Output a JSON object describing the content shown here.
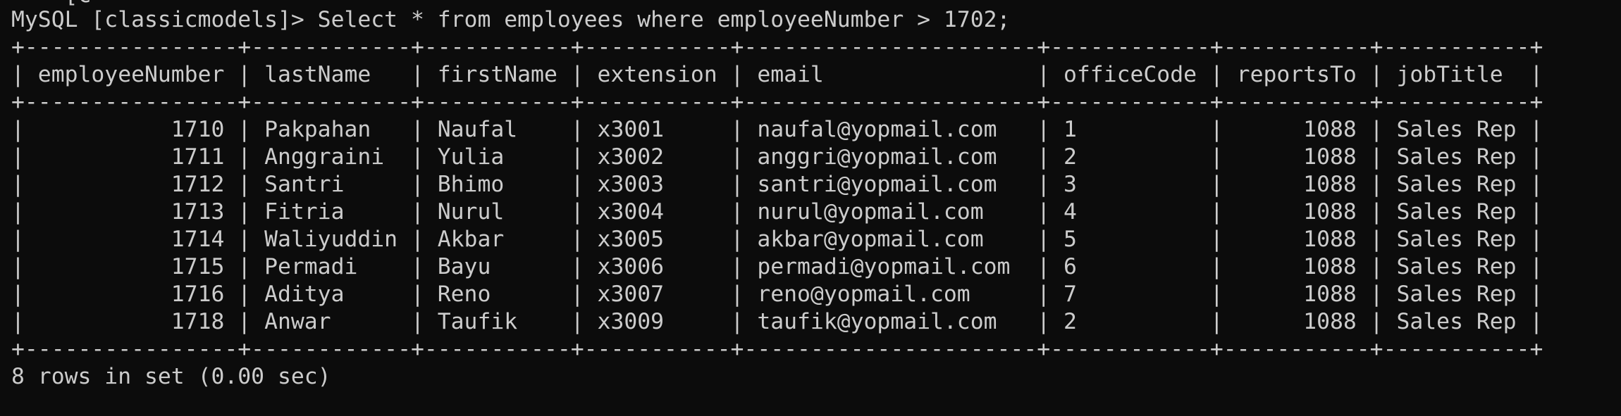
{
  "terminal": {
    "clipped_top_line": "    [c",
    "prompt_line": "MySQL [classicmodels]> Select * from employees where employeeNumber > 1702;",
    "table": {
      "border": "+----------------+------------+-----------+-----------+----------------------+------------+-----------+-----------+",
      "header": "| employeeNumber | lastName   | firstName | extension | email                | officeCode | reportsTo | jobTitle  |",
      "rows": [
        "|           1710 | Pakpahan   | Naufal    | x3001     | naufal@yopmail.com   | 1          |      1088 | Sales Rep |",
        "|           1711 | Anggraini  | Yulia     | x3002     | anggri@yopmail.com   | 2          |      1088 | Sales Rep |",
        "|           1712 | Santri     | Bhimo     | x3003     | santri@yopmail.com   | 3          |      1088 | Sales Rep |",
        "|           1713 | Fitria     | Nurul     | x3004     | nurul@yopmail.com    | 4          |      1088 | Sales Rep |",
        "|           1714 | Waliyuddin | Akbar     | x3005     | akbar@yopmail.com    | 5          |      1088 | Sales Rep |",
        "|           1715 | Permadi    | Bayu      | x3006     | permadi@yopmail.com  | 6          |      1088 | Sales Rep |",
        "|           1716 | Aditya     | Reno      | x3007     | reno@yopmail.com     | 7          |      1088 | Sales Rep |",
        "|           1718 | Anwar      | Taufik    | x3009     | taufik@yopmail.com   | 2          |      1088 | Sales Rep |"
      ]
    },
    "result_line": "8 rows in set (0.00 sec)",
    "colors": {
      "background": "#0c0c0c",
      "text": "#cccccc"
    }
  }
}
